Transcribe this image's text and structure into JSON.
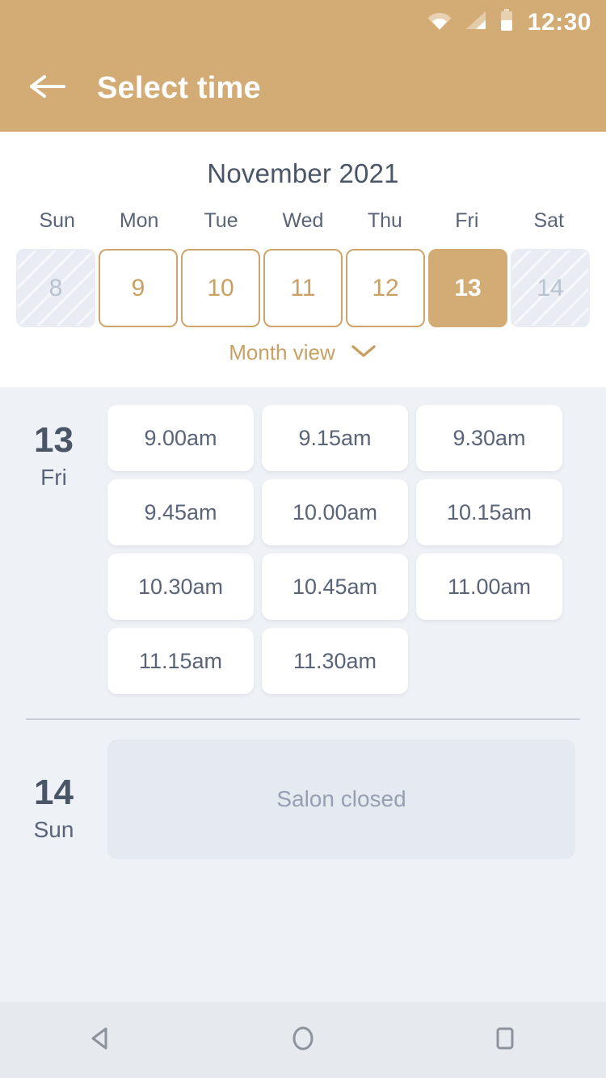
{
  "status_bar": {
    "time": "12:30",
    "icons": [
      "wifi-icon",
      "signal-icon",
      "battery-icon"
    ]
  },
  "app_bar": {
    "title": "Select time",
    "back_icon": "arrow-left-icon"
  },
  "calendar": {
    "month_title": "November 2021",
    "weekdays": [
      "Sun",
      "Mon",
      "Tue",
      "Wed",
      "Thu",
      "Fri",
      "Sat"
    ],
    "days": [
      {
        "num": "8",
        "state": "disabled"
      },
      {
        "num": "9",
        "state": "available"
      },
      {
        "num": "10",
        "state": "available"
      },
      {
        "num": "11",
        "state": "available"
      },
      {
        "num": "12",
        "state": "available"
      },
      {
        "num": "13",
        "state": "selected"
      },
      {
        "num": "14",
        "state": "disabled"
      }
    ],
    "month_view_label": "Month view",
    "month_view_icon": "chevron-down-icon"
  },
  "schedule": {
    "days": [
      {
        "day_number": "13",
        "day_of_week": "Fri",
        "slots": [
          "9.00am",
          "9.15am",
          "9.30am",
          "9.45am",
          "10.00am",
          "10.15am",
          "10.30am",
          "10.45am",
          "11.00am",
          "11.15am",
          "11.30am"
        ]
      },
      {
        "day_number": "14",
        "day_of_week": "Sun",
        "closed_message": "Salon closed"
      }
    ]
  },
  "nav_bar": {
    "back": "nav-back-icon",
    "home": "nav-home-icon",
    "recents": "nav-recents-icon"
  },
  "colors": {
    "accent": "#d3ab74",
    "accent_border": "#cfa469",
    "accent_text": "#c9a063",
    "text_dark": "#4a5568",
    "text_muted": "#5a6478",
    "bg_panel": "#eef1f6",
    "bg_card": "#ffffff",
    "closed_card": "#e5e9f0",
    "closed_text": "#97a0b3",
    "nav_bg": "#e6e9ee"
  }
}
